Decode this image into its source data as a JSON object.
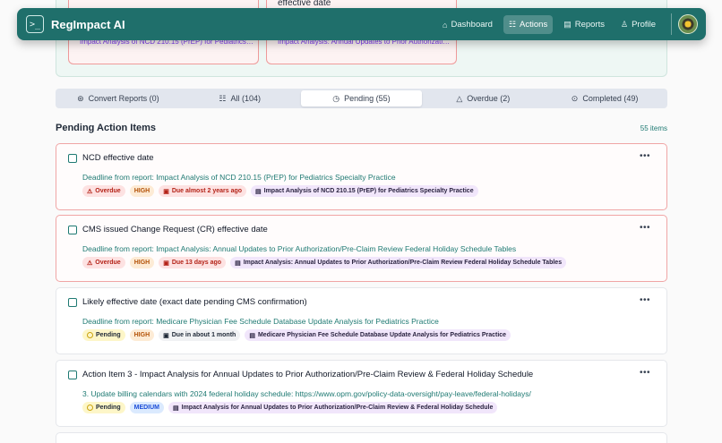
{
  "header": {
    "logo_glyph": ">_",
    "title": "RegImpact AI",
    "nav": [
      {
        "label": "Dashboard",
        "icon": "home-icon",
        "glyph": "⌂"
      },
      {
        "label": "Actions",
        "icon": "list-icon",
        "glyph": "☷"
      },
      {
        "label": "Reports",
        "icon": "file-icon",
        "glyph": "▤"
      },
      {
        "label": "Profile",
        "icon": "user-icon",
        "glyph": "♙"
      }
    ]
  },
  "peek": {
    "left_link": "Impact Analysis of NCD 210.15 (PrEP) for Pediatrics S...",
    "right_title": "effective date",
    "right_link": "Impact Analysis: Annual Updates to Prior Authorization..."
  },
  "tabs": [
    {
      "label": "Convert Reports (0)",
      "icon": "convert-icon",
      "glyph": "⊛"
    },
    {
      "label": "All (104)",
      "icon": "list-icon",
      "glyph": "☷"
    },
    {
      "label": "Pending (55)",
      "icon": "clock-icon",
      "glyph": "◷"
    },
    {
      "label": "Overdue (2)",
      "icon": "warning-icon",
      "glyph": "△"
    },
    {
      "label": "Completed (49)",
      "icon": "check-circle-icon",
      "glyph": "⊙"
    }
  ],
  "section": {
    "title": "Pending Action Items",
    "count": "55 items"
  },
  "cards": [
    {
      "title": "NCD effective date",
      "link": "Deadline from report: Impact Analysis of NCD 210.15 (PrEP) for Pediatrics Specialty Practice",
      "status": "Overdue",
      "priority": "HIGH",
      "due": "Due almost 2 years ago",
      "report": "Impact Analysis of NCD 210.15 (PrEP) for Pediatrics Specialty Practice"
    },
    {
      "title": "CMS issued Change Request (CR) effective date",
      "link": "Deadline from report: Impact Analysis: Annual Updates to Prior Authorization/Pre-Claim Review Federal Holiday Schedule Tables",
      "status": "Overdue",
      "priority": "HIGH",
      "due": "Due 13 days ago",
      "report": "Impact Analysis: Annual Updates to Prior Authorization/Pre-Claim Review Federal Holiday Schedule Tables"
    },
    {
      "title": "Likely effective date (exact date pending CMS confirmation)",
      "link": "Deadline from report: Medicare Physician Fee Schedule Database Update Analysis for Pediatrics Practice",
      "status": "Pending",
      "priority": "HIGH",
      "due": "Due in about 1 month",
      "report": "Medicare Physician Fee Schedule Database Update Analysis for Pediatrics Practice"
    },
    {
      "title": "Action Item 3 - Impact Analysis for Annual Updates to Prior Authorization/Pre-Claim Review & Federal Holiday Schedule",
      "link": "3. Update billing calendars with 2024 federal holiday schedule: https://www.opm.gov/policy-data-oversight/pay-leave/federal-holidays/",
      "status": "Pending",
      "priority": "MEDIUM",
      "report": "Impact Analysis for Annual Updates to Prior Authorization/Pre-Claim Review & Federal Holiday Schedule"
    }
  ],
  "colors": {
    "brand": "#1f6f6b",
    "overdue": "#b42318",
    "link": "#1f7a73"
  }
}
